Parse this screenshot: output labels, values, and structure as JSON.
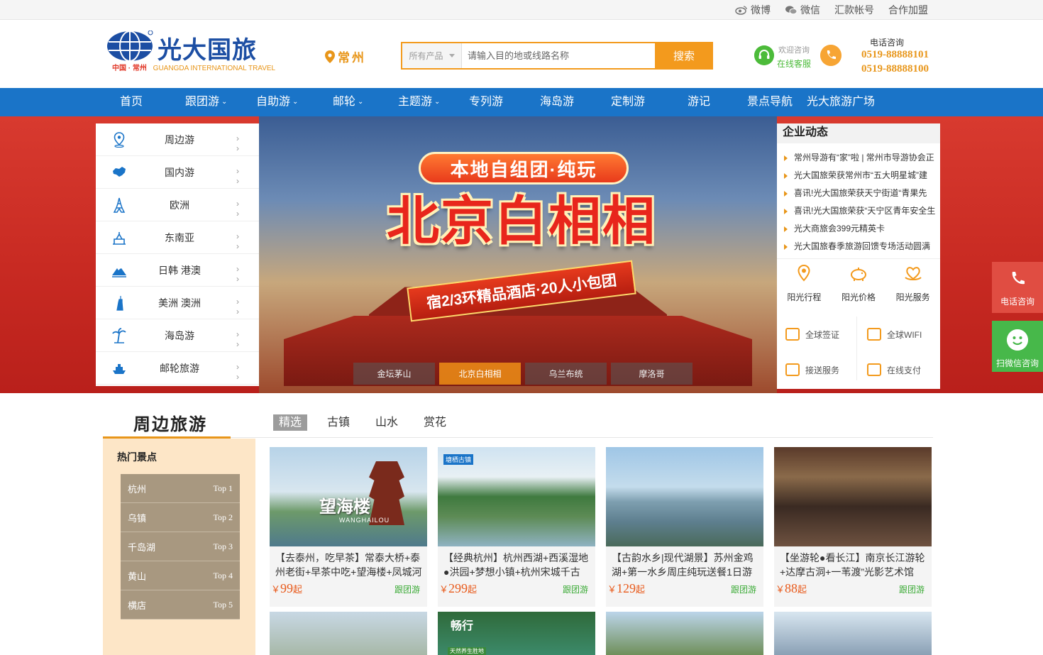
{
  "topbar": {
    "links": [
      {
        "label": "微博",
        "icon": "weibo-icon"
      },
      {
        "label": "微信",
        "icon": "wechat-icon"
      },
      {
        "label": "汇款帐号",
        "icon": ""
      },
      {
        "label": "合作加盟",
        "icon": ""
      }
    ]
  },
  "header": {
    "logo": {
      "name": "光大国旅",
      "sub_prefix": "中国 · 常州",
      "sub_en": "GUANGDA INTERNATIONAL TRAVEL"
    },
    "city": "常州",
    "search": {
      "category": "所有产品",
      "placeholder": "请输入目的地或线路名称",
      "button": "搜索"
    },
    "service": {
      "line1": "欢迎咨询",
      "line2": "在线客服"
    },
    "phone": {
      "title": "电话咨询",
      "numbers": [
        "0519-88888101",
        "0519-88888100"
      ]
    }
  },
  "nav": {
    "items": [
      {
        "label": "首页",
        "dropdown": false
      },
      {
        "label": "跟团游",
        "dropdown": true
      },
      {
        "label": "自助游",
        "dropdown": true
      },
      {
        "label": "邮轮",
        "dropdown": true
      },
      {
        "label": "主题游",
        "dropdown": true
      },
      {
        "label": "专列游",
        "dropdown": false
      },
      {
        "label": "海岛游",
        "dropdown": false
      },
      {
        "label": "定制游",
        "dropdown": false
      },
      {
        "label": "游记",
        "dropdown": false
      },
      {
        "label": "景点导航",
        "dropdown": false
      },
      {
        "label": "光大旅游广场",
        "dropdown": false
      }
    ]
  },
  "categories": [
    {
      "label": "周边游",
      "icon": "map-pin-icon"
    },
    {
      "label": "国内游",
      "icon": "china-map-icon"
    },
    {
      "label": "欧洲",
      "icon": "eiffel-tower-icon"
    },
    {
      "label": "东南亚",
      "icon": "temple-icon"
    },
    {
      "label": "日韩 港澳",
      "icon": "mount-fuji-icon"
    },
    {
      "label": "美洲 澳洲",
      "icon": "statue-of-liberty-icon"
    },
    {
      "label": "海岛游",
      "icon": "palm-tree-icon"
    },
    {
      "label": "邮轮旅游",
      "icon": "cruise-ship-icon"
    }
  ],
  "banner": {
    "tag": "本地自组团·纯玩",
    "headline": "北京白相相",
    "ribbon": "宿2/3环精品酒店·20人小包团",
    "thumbs": [
      {
        "label": "金坛茅山",
        "active": false
      },
      {
        "label": "北京白相相",
        "active": true
      },
      {
        "label": "乌兰布统",
        "active": false
      },
      {
        "label": "摩洛哥",
        "active": false
      }
    ]
  },
  "news": {
    "title": "企业动态",
    "items": [
      "常州导游有“家”啦 | 常州市导游协会正",
      "光大国旅荣获常州市“五大明星城”建",
      "喜讯!光大国旅荣获天宁街道“青果先",
      "喜讯!光大国旅荣获“天宁区青年安全生",
      "光大商旅会399元精英卡",
      "光大国旅春季旅游回馈专场活动圆满"
    ],
    "services": [
      {
        "label": "阳光行程",
        "icon": "location-icon"
      },
      {
        "label": "阳光价格",
        "icon": "piggy-bank-icon"
      },
      {
        "label": "阳光服务",
        "icon": "heart-hands-icon"
      }
    ],
    "grid": [
      {
        "label": "全球签证",
        "icon": "visa-icon"
      },
      {
        "label": "全球WIFI",
        "icon": "wifi-icon"
      },
      {
        "label": "接送服务",
        "icon": "car-icon"
      },
      {
        "label": "在线支付",
        "icon": "payment-icon"
      }
    ]
  },
  "float": {
    "phone": "电话咨询",
    "wechat": "扫微信咨询"
  },
  "section": {
    "title": "周边旅游",
    "tabs": [
      {
        "label": "精选",
        "active": true
      },
      {
        "label": "古镇",
        "active": false
      },
      {
        "label": "山水",
        "active": false
      },
      {
        "label": "赏花",
        "active": false
      }
    ],
    "hot_title": "热门景点",
    "hot": [
      {
        "name": "杭州",
        "rank": "Top 1"
      },
      {
        "name": "乌镇",
        "rank": "Top 2"
      },
      {
        "name": "千岛湖",
        "rank": "Top 3"
      },
      {
        "name": "黄山",
        "rank": "Top 4"
      },
      {
        "name": "横店",
        "rank": "Top 5"
      }
    ],
    "products": [
      {
        "title": "【去泰州，吃早茶】常泰大桥+泰州老街+早茶中吃+望海楼+凤城河",
        "price": "99",
        "unit": "起",
        "type": "跟团游",
        "currency": "￥",
        "img_caption": "望海楼",
        "img_caption_en": "WANGHAILOU"
      },
      {
        "title": "【经典杭州】杭州西湖+西溪湿地●洪园+梦想小镇+杭州宋城千古",
        "price": "299",
        "unit": "起",
        "type": "跟团游",
        "currency": "￥",
        "img_caption": "塘栖古镇"
      },
      {
        "title": "【古韵水乡|现代湖景】苏州金鸡湖+第一水乡周庄纯玩送餐1日游",
        "price": "129",
        "unit": "起",
        "type": "跟团游",
        "currency": "￥"
      },
      {
        "title": "【坐游轮●看长江】南京长江游轮+达摩古洞+一苇渡”光影艺术馆",
        "price": "88",
        "unit": "起",
        "type": "跟团游",
        "currency": "￥"
      }
    ],
    "row2_caption": "畅行",
    "row2_sub": "天然养生胜地"
  }
}
